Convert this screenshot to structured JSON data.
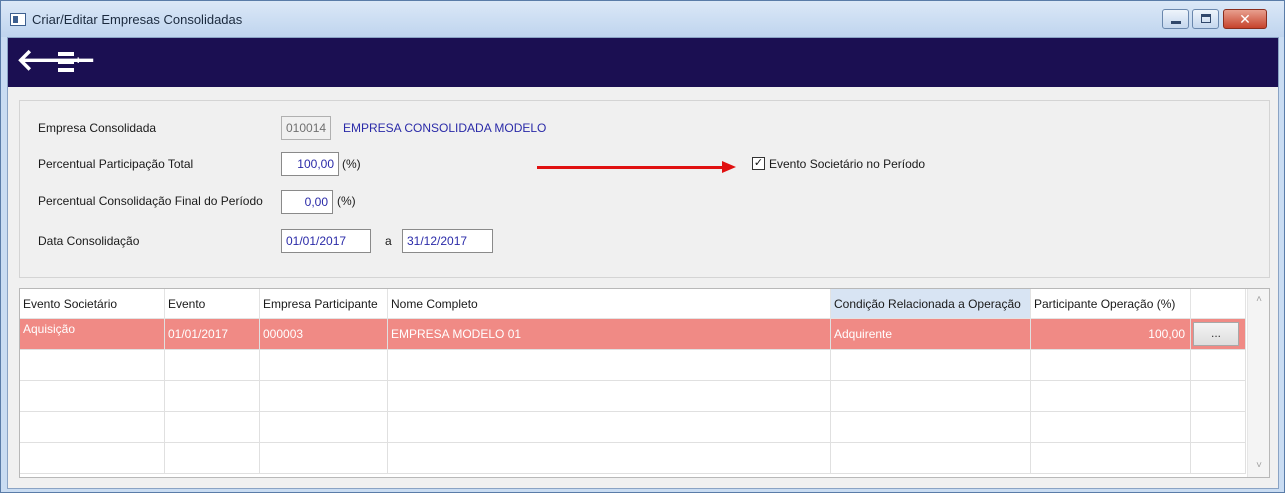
{
  "window": {
    "title": "Criar/Editar Empresas Consolidadas",
    "close_glyph": "✕"
  },
  "toolbar": {
    "back_icon": "arrow-left-icon",
    "back_glyph": "🡐",
    "menu_icon": "list-add-icon",
    "menu_plus": "+"
  },
  "form": {
    "empresa_label": "Empresa Consolidada",
    "empresa_code": "010014",
    "empresa_name": "EMPRESA CONSOLIDADA MODELO",
    "percentual_total_label": "Percentual Participação Total",
    "percentual_total_value": "100,00",
    "percent_unit": "(%)",
    "percentual_final_label": "Percentual Consolidação Final do Período",
    "percentual_final_value": "0,00",
    "data_label": "Data Consolidação",
    "data_inicio": "01/01/2017",
    "data_sep": "a",
    "data_fim": "31/12/2017",
    "evento_checkbox_label": "Evento Societário no Período",
    "evento_checked": true,
    "check_glyph": "✓"
  },
  "grid": {
    "columns": [
      "Evento Societário",
      "Evento",
      "Empresa Participante",
      "Nome Completo",
      "Condição Relacionada a Operação",
      "Participante Operação (%)"
    ],
    "rows": [
      {
        "evento_societario": "Aquisição",
        "evento": "01/01/2017",
        "empresa": "000003",
        "nome": "EMPRESA MODELO 01",
        "condicao": "Adquirente",
        "participacao": "100,00",
        "action_label": "..."
      }
    ],
    "scroll_up": "˄",
    "scroll_down": "˅"
  },
  "colors": {
    "toolbar_bg": "#1b0f52",
    "selected_row": "#f08a85",
    "link_text": "#2a2aa8",
    "arrow_annotation": "#e01010"
  }
}
